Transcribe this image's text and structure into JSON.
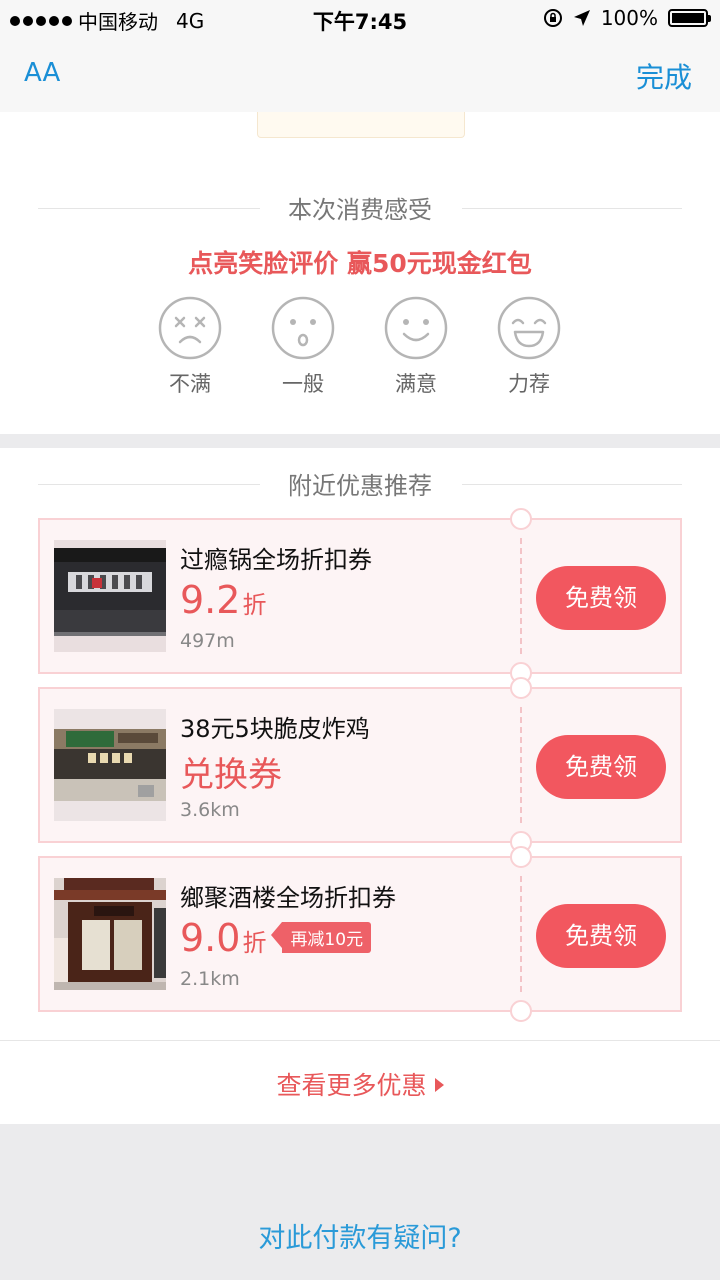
{
  "status_bar": {
    "carrier": "中国移动",
    "network": "4G",
    "time": "下午7:45",
    "battery": "100%"
  },
  "nav": {
    "font_size_label": "AA",
    "done_label": "完成"
  },
  "feedback": {
    "title": "本次消费感受",
    "promo": "点亮笑脸评价  赢50元现金红包",
    "faces": [
      {
        "label": "不满",
        "icon": "dissatisfied-face-icon"
      },
      {
        "label": "一般",
        "icon": "neutral-face-icon"
      },
      {
        "label": "满意",
        "icon": "satisfied-face-icon"
      },
      {
        "label": "力荐",
        "icon": "highly-recommend-face-icon"
      }
    ]
  },
  "nearby": {
    "title": "附近优惠推荐",
    "coupons": [
      {
        "name": "过瘾锅全场折扣券",
        "value": "9.2",
        "unit": "折",
        "tag": "",
        "distance": "497m",
        "button": "免费领"
      },
      {
        "name": "38元5块脆皮炸鸡",
        "value": "兑换券",
        "unit": "",
        "tag": "",
        "distance": "3.6km",
        "button": "免费领"
      },
      {
        "name": "鄉聚酒楼全场折扣券",
        "value": "9.0",
        "unit": "折",
        "tag": "再减10元",
        "distance": "2.1km",
        "button": "免费领"
      }
    ],
    "more_label": "查看更多优惠"
  },
  "footer": {
    "question": "对此付款有疑问?"
  },
  "colors": {
    "accent_red": "#e8585a",
    "button_red": "#f2575f",
    "link_blue": "#1a8fd6"
  }
}
